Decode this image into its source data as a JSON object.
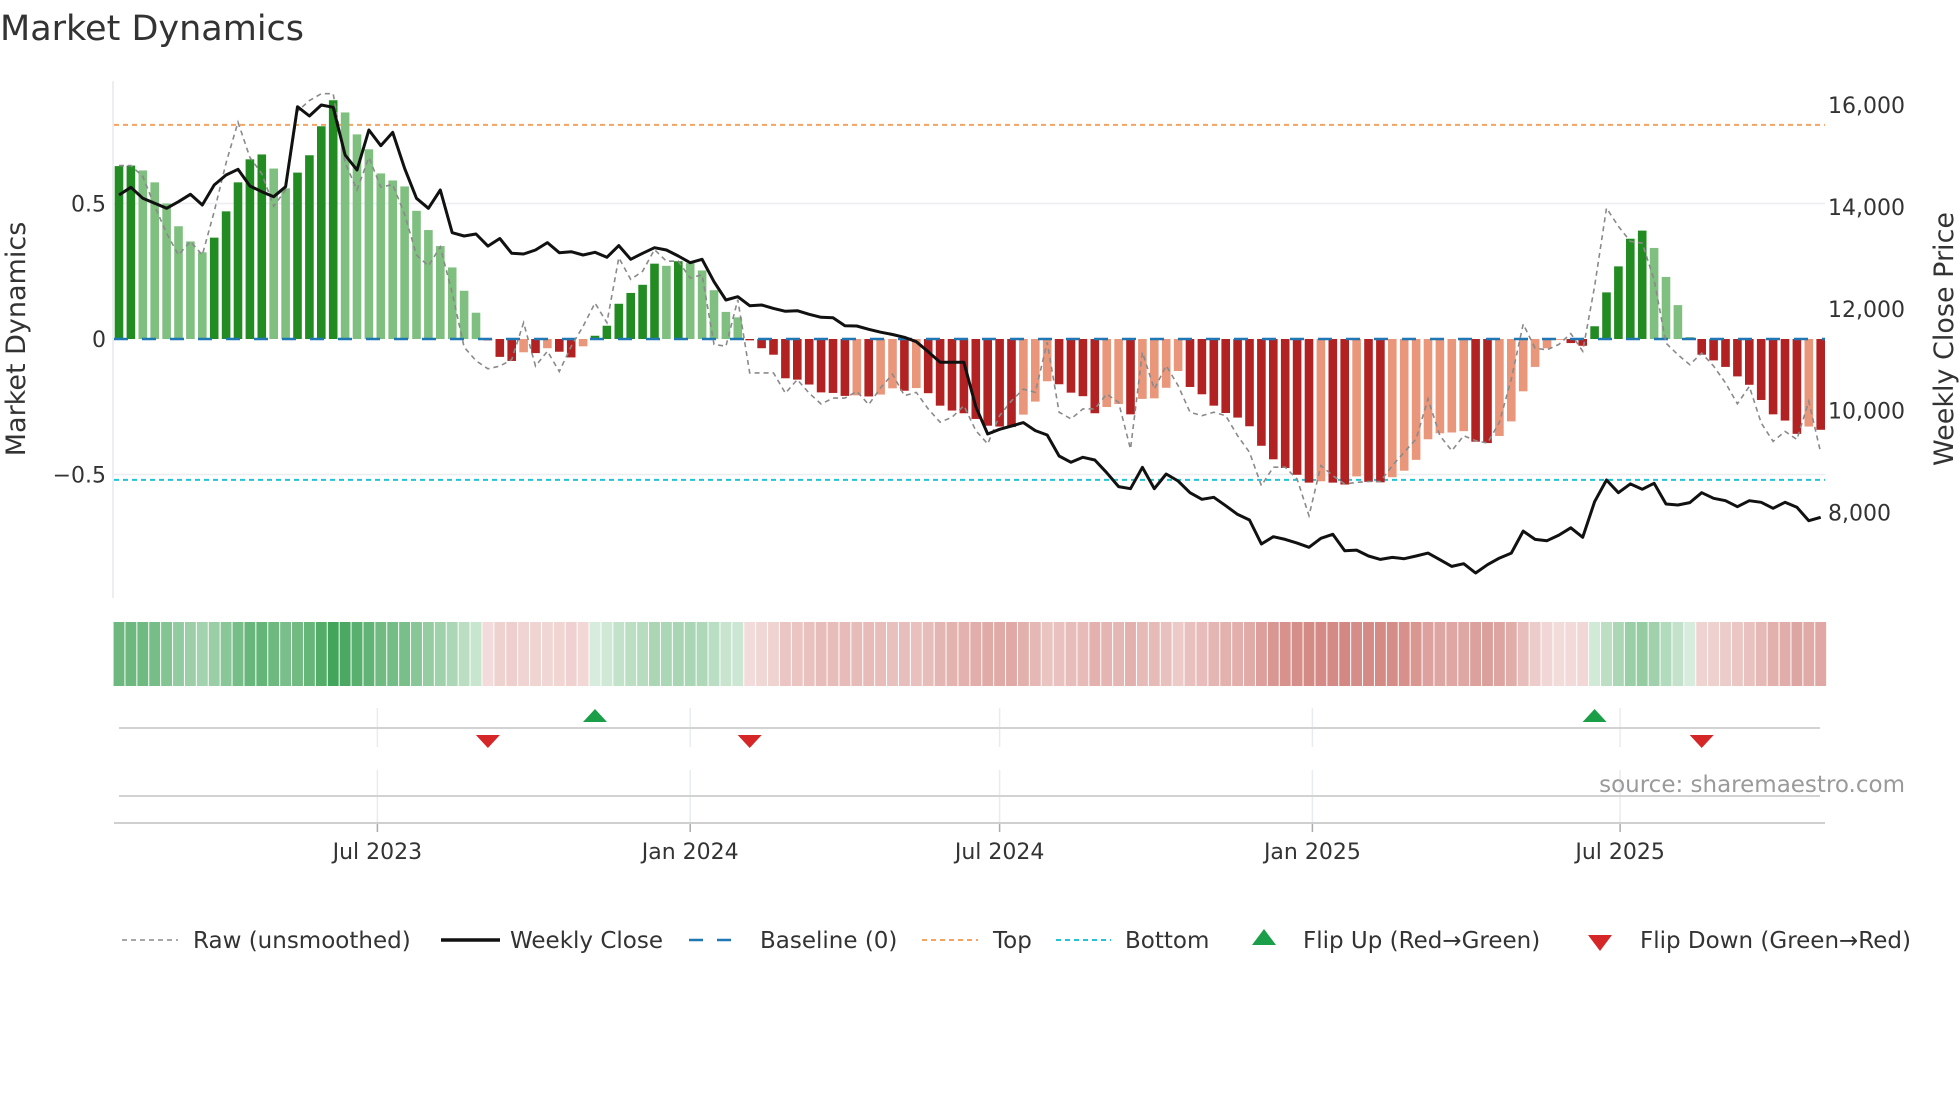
{
  "title": "Market Dynamics",
  "source": "source: sharemaestro.com",
  "colors": {
    "strong_green": "#228b22",
    "weak_green": "#7fbf7f",
    "strong_red": "#b22222",
    "weak_red": "#e9967a",
    "close": "#111111",
    "raw": "#8a8a8a",
    "baseline": "#1f77b4",
    "top": "#f4a460",
    "bottom": "#22c3d6",
    "flip_up": "#1a9e47",
    "flip_down": "#d62728",
    "heat_green": "#40a358",
    "heat_red": "#bf5049"
  },
  "chart_data": {
    "type": "bar",
    "title": "Market Dynamics",
    "ylabel": "Market Dynamics",
    "y2label": "Weekly Close Price",
    "ylim": [
      -0.87,
      0.97
    ],
    "y2lim": [
      6300,
      16600
    ],
    "start_date": "2023-01-30",
    "frequency": "weekly",
    "y_ticks": [
      {
        "value": 0.5,
        "label": "0.5"
      },
      {
        "value": 0,
        "label": "0"
      },
      {
        "value": -0.5,
        "label": "−0.5"
      }
    ],
    "y2_ticks": [
      {
        "value": 16000,
        "label": "16,000"
      },
      {
        "value": 14000,
        "label": "14,000"
      },
      {
        "value": 12000,
        "label": "12,000"
      },
      {
        "value": 10000,
        "label": "10,000"
      },
      {
        "value": 8000,
        "label": "8,000"
      }
    ],
    "x_ticks": [
      {
        "date": "2023-07-01",
        "label": "Jul 2023"
      },
      {
        "date": "2024-01-01",
        "label": "Jan 2024"
      },
      {
        "date": "2024-07-01",
        "label": "Jul 2024"
      },
      {
        "date": "2025-01-01",
        "label": "Jan 2025"
      },
      {
        "date": "2025-07-01",
        "label": "Jul 2025"
      }
    ],
    "baseline": 0,
    "top": 0.79,
    "bottom": -0.52,
    "momentum": [
      0.638,
      0.64,
      0.622,
      0.578,
      0.5,
      0.416,
      0.36,
      0.32,
      0.374,
      0.471,
      0.578,
      0.663,
      0.681,
      0.629,
      0.556,
      0.614,
      0.678,
      0.785,
      0.881,
      0.836,
      0.755,
      0.7,
      0.611,
      0.585,
      0.563,
      0.473,
      0.402,
      0.343,
      0.264,
      0.178,
      0.097,
      -0.005,
      -0.066,
      -0.081,
      -0.049,
      -0.052,
      -0.034,
      -0.047,
      -0.068,
      -0.027,
      0.012,
      0.049,
      0.13,
      0.17,
      0.2,
      0.278,
      0.27,
      0.287,
      0.28,
      0.253,
      0.18,
      0.1,
      0.08,
      -0.005,
      -0.034,
      -0.058,
      -0.145,
      -0.15,
      -0.168,
      -0.197,
      -0.199,
      -0.21,
      -0.208,
      -0.212,
      -0.205,
      -0.182,
      -0.191,
      -0.181,
      -0.2,
      -0.246,
      -0.264,
      -0.274,
      -0.295,
      -0.32,
      -0.323,
      -0.325,
      -0.279,
      -0.231,
      -0.156,
      -0.167,
      -0.198,
      -0.211,
      -0.274,
      -0.251,
      -0.24,
      -0.278,
      -0.221,
      -0.219,
      -0.18,
      -0.118,
      -0.177,
      -0.204,
      -0.246,
      -0.273,
      -0.29,
      -0.322,
      -0.394,
      -0.444,
      -0.476,
      -0.501,
      -0.53,
      -0.525,
      -0.53,
      -0.537,
      -0.507,
      -0.527,
      -0.529,
      -0.51,
      -0.486,
      -0.446,
      -0.37,
      -0.348,
      -0.345,
      -0.34,
      -0.379,
      -0.384,
      -0.358,
      -0.304,
      -0.193,
      -0.103,
      -0.034,
      -0.003,
      -0.015,
      -0.025,
      0.047,
      0.172,
      0.268,
      0.37,
      0.4,
      0.336,
      0.229,
      0.125,
      0.007,
      -0.058,
      -0.079,
      -0.103,
      -0.138,
      -0.169,
      -0.225,
      -0.278,
      -0.301,
      -0.35,
      -0.323,
      -0.335
    ],
    "raw": [
      0.64,
      0.64,
      0.6,
      0.49,
      0.39,
      0.31,
      0.36,
      0.31,
      0.47,
      0.65,
      0.8,
      0.67,
      0.61,
      0.49,
      0.55,
      0.84,
      0.88,
      0.905,
      0.905,
      0.65,
      0.55,
      0.67,
      0.56,
      0.57,
      0.46,
      0.31,
      0.27,
      0.34,
      0.17,
      -0.03,
      -0.08,
      -0.11,
      -0.1,
      -0.076,
      0.06,
      -0.1,
      -0.045,
      -0.12,
      -0.027,
      0.047,
      0.133,
      0.06,
      0.3,
      0.22,
      0.25,
      0.33,
      0.287,
      0.287,
      0.225,
      0.237,
      -0.02,
      -0.027,
      0.145,
      -0.125,
      -0.125,
      -0.125,
      -0.2,
      -0.15,
      -0.2,
      -0.24,
      -0.218,
      -0.218,
      -0.193,
      -0.242,
      -0.18,
      -0.13,
      -0.209,
      -0.197,
      -0.258,
      -0.307,
      -0.289,
      -0.246,
      -0.338,
      -0.387,
      -0.283,
      -0.228,
      -0.185,
      -0.197,
      -0.012,
      -0.27,
      -0.295,
      -0.258,
      -0.258,
      -0.203,
      -0.234,
      -0.406,
      -0.049,
      -0.185,
      -0.098,
      -0.172,
      -0.27,
      -0.283,
      -0.27,
      -0.283,
      -0.357,
      -0.418,
      -0.541,
      -0.473,
      -0.473,
      -0.517,
      -0.652,
      -0.467,
      -0.504,
      -0.535,
      -0.529,
      -0.526,
      -0.526,
      -0.467,
      -0.418,
      -0.369,
      -0.221,
      -0.357,
      -0.412,
      -0.357,
      -0.375,
      -0.384,
      -0.307,
      -0.148,
      0.055,
      -0.034,
      -0.04,
      -0.02,
      0.02,
      -0.045,
      0.194,
      0.483,
      0.416,
      0.36,
      0.354,
      0.219,
      -0.015,
      -0.058,
      -0.095,
      -0.052,
      -0.1,
      -0.162,
      -0.239,
      -0.175,
      -0.31,
      -0.378,
      -0.341,
      -0.371,
      -0.23,
      -0.42
    ],
    "close": [
      14233,
      14384,
      14168,
      14070,
      13972,
      14102,
      14247,
      14037,
      14430,
      14626,
      14738,
      14410,
      14298,
      14200,
      14397,
      15967,
      15784,
      16000,
      15955,
      15018,
      14724,
      15509,
      15201,
      15463,
      14757,
      14168,
      13972,
      14331,
      13494,
      13429,
      13468,
      13230,
      13380,
      13089,
      13075,
      13154,
      13298,
      13101,
      13121,
      13056,
      13108,
      13010,
      13239,
      12971,
      13089,
      13199,
      13154,
      13036,
      12905,
      12971,
      12532,
      12172,
      12237,
      12060,
      12074,
      12008,
      11950,
      11962,
      11891,
      11832,
      11825,
      11668,
      11662,
      11597,
      11540,
      11495,
      11439,
      11354,
      11158,
      10949,
      10949,
      10949,
      10078,
      9542,
      9634,
      9699,
      9765,
      9608,
      9522,
      9110,
      8986,
      9084,
      9031,
      8782,
      8508,
      8468,
      8888,
      8468,
      8756,
      8619,
      8390,
      8259,
      8298,
      8134,
      7964,
      7853,
      7382,
      7525,
      7473,
      7400,
      7317,
      7494,
      7572,
      7251,
      7263,
      7146,
      7080,
      7119,
      7093,
      7146,
      7204,
      7073,
      6942,
      6995,
      6812,
      6975,
      7106,
      7204,
      7636,
      7472,
      7446,
      7557,
      7700,
      7514,
      8213,
      8639,
      8390,
      8561,
      8456,
      8574,
      8168,
      8148,
      8194,
      8390,
      8279,
      8233,
      8115,
      8233,
      8200,
      8082,
      8200,
      8102,
      7840,
      7906
    ],
    "flip_up_dates": [
      "2023-11-06",
      "2025-06-16"
    ],
    "flip_down_dates": [
      "2023-09-04",
      "2024-02-05",
      "2025-08-18"
    ],
    "legend": [
      {
        "key": "raw",
        "label": "Raw (unsmoothed)"
      },
      {
        "key": "close",
        "label": "Weekly Close"
      },
      {
        "key": "baseline",
        "label": "Baseline (0)"
      },
      {
        "key": "top",
        "label": "Top"
      },
      {
        "key": "bottom",
        "label": "Bottom"
      },
      {
        "key": "flip_up",
        "label": "Flip Up (Red→Green)"
      },
      {
        "key": "flip_down",
        "label": "Flip Down (Green→Red)"
      }
    ],
    "legend_position": "bottom"
  }
}
